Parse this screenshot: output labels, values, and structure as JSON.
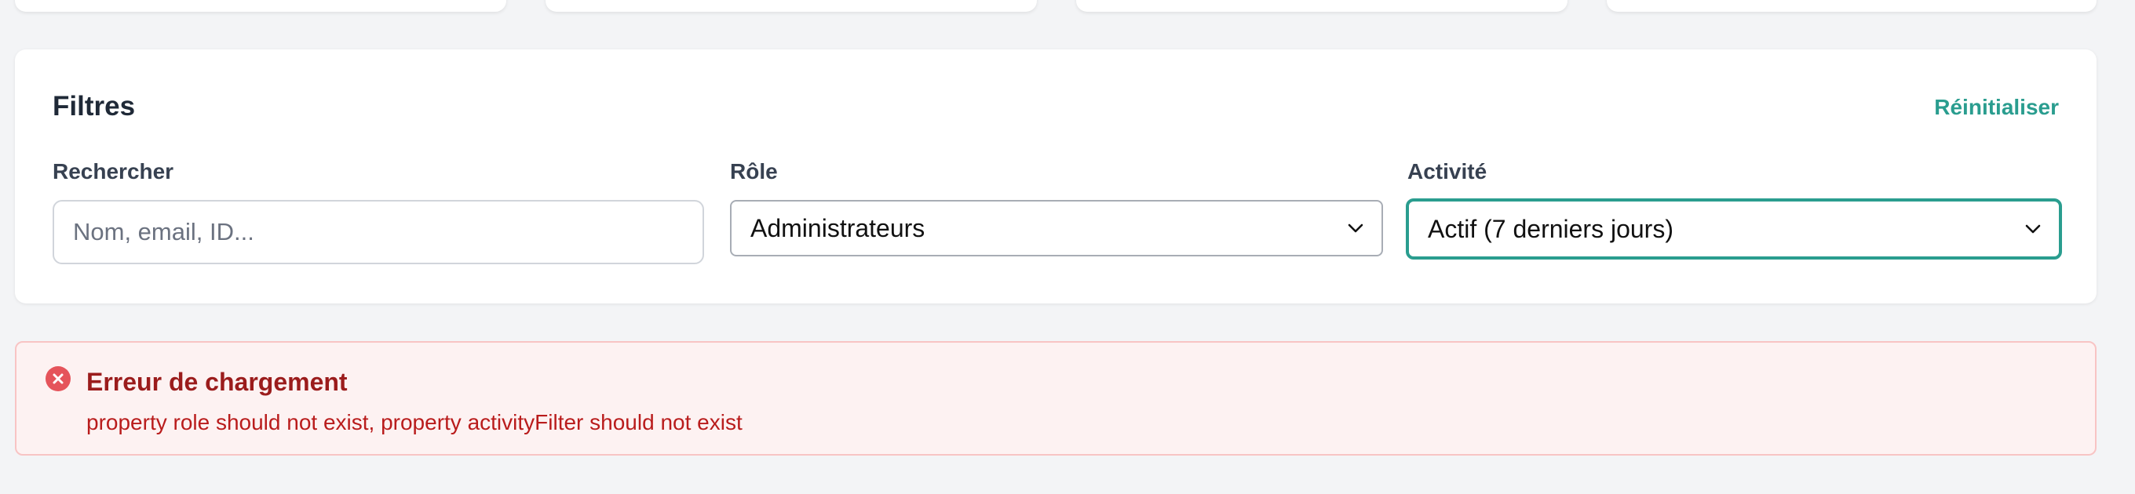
{
  "filters": {
    "title": "Filtres",
    "reset_label": "Réinitialiser",
    "search": {
      "label": "Rechercher",
      "placeholder": "Nom, email, ID...",
      "value": ""
    },
    "role": {
      "label": "Rôle",
      "selected": "Administrateurs"
    },
    "activity": {
      "label": "Activité",
      "selected": "Actif (7 derniers jours)"
    }
  },
  "error": {
    "icon": "x-circle-icon",
    "title": "Erreur de chargement",
    "message": "property role should not exist, property activityFilter should not exist"
  },
  "colors": {
    "accent": "#2a9d8f",
    "error_text": "#9b1c1c",
    "error_bg": "#fdf2f2",
    "error_border": "#f8c4c4",
    "page_bg": "#f3f4f6"
  }
}
